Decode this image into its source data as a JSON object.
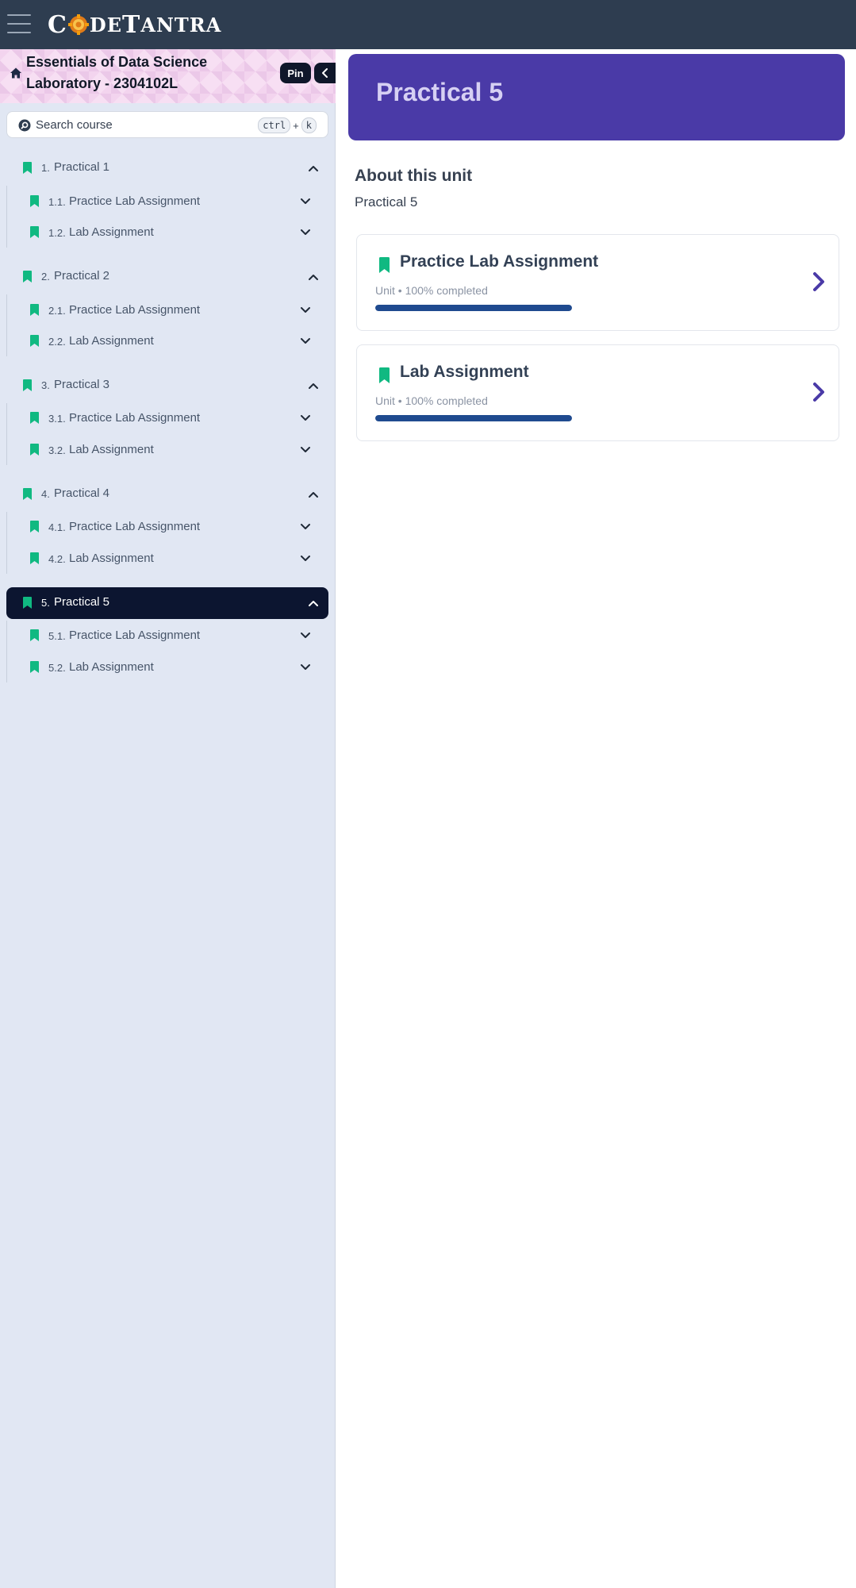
{
  "header": {
    "logo_first": "C",
    "logo_mid": "DE",
    "logo_t": "T",
    "logo_rest": "ANTRA",
    "menu_icon": "hamburger-menu-icon",
    "brand_color": "#2e3d50"
  },
  "sidebar": {
    "course_title": "Essentials of Data Science Laboratory - 2304102L",
    "pin_label": "Pin",
    "search": {
      "placeholder": "Search course",
      "shortcut_key1": "ctrl",
      "shortcut_plus": "+",
      "shortcut_key2": "k"
    },
    "accent_color": "#10b981",
    "units": [
      {
        "num": "1.",
        "label": "Practical 1",
        "active": false,
        "children": [
          {
            "num": "1.1.",
            "label": "Practice Lab Assignment"
          },
          {
            "num": "1.2.",
            "label": "Lab Assignment"
          }
        ]
      },
      {
        "num": "2.",
        "label": "Practical 2",
        "active": false,
        "children": [
          {
            "num": "2.1.",
            "label": "Practice Lab Assignment"
          },
          {
            "num": "2.2.",
            "label": "Lab Assignment"
          }
        ]
      },
      {
        "num": "3.",
        "label": "Practical 3",
        "active": false,
        "children": [
          {
            "num": "3.1.",
            "label": "Practice Lab Assignment"
          },
          {
            "num": "3.2.",
            "label": "Lab Assignment"
          }
        ]
      },
      {
        "num": "4.",
        "label": "Practical 4",
        "active": false,
        "children": [
          {
            "num": "4.1.",
            "label": "Practice Lab Assignment"
          },
          {
            "num": "4.2.",
            "label": "Lab Assignment"
          }
        ]
      },
      {
        "num": "5.",
        "label": "Practical 5",
        "active": true,
        "children": [
          {
            "num": "5.1.",
            "label": "Practice Lab Assignment"
          },
          {
            "num": "5.2.",
            "label": "Lab Assignment"
          }
        ]
      }
    ]
  },
  "main": {
    "banner_title": "Practical 5",
    "banner_color": "#4a3aa7",
    "about_heading": "About this unit",
    "about_text": "Practical 5",
    "cards": [
      {
        "title": "Practice Lab Assignment",
        "meta": "Unit • 100% completed",
        "progress": 1.0
      },
      {
        "title": "Lab Assignment",
        "meta": "Unit • 100% completed",
        "progress": 1.0
      }
    ]
  }
}
